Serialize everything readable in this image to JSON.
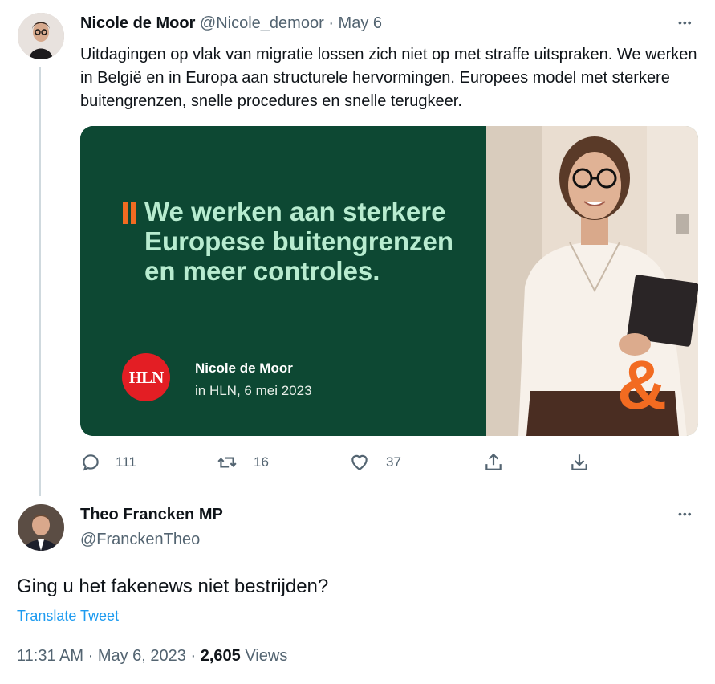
{
  "tweet1": {
    "author_name": "Nicole de Moor",
    "handle": "@Nicole_demoor",
    "separator": "·",
    "date": "May 6",
    "more": "•••",
    "text": "Uitdagingen op vlak van migratie lossen zich niet op met straffe uitspraken. We werken in België en in Europa aan structurele hervormingen. Europees model met sterkere buitengrenzen, snelle procedures en snelle terugkeer.",
    "card": {
      "headline": "We werken aan sterkere Europese buitengrenzen en meer controles.",
      "logo_text": "HLN",
      "author": "Nicole de Moor",
      "source": "in HLN, 6 mei 2023",
      "bg_color": "#0d4833",
      "headline_color": "#b8ecd0",
      "accent_color": "#f26b21"
    },
    "actions": {
      "reply_count": "111",
      "retweet_count": "16",
      "like_count": "37"
    }
  },
  "tweet2": {
    "author_name": "Theo Francken MP",
    "handle": "@FranckenTheo",
    "more": "•••",
    "text": "Ging u het fakenews niet bestrijden?",
    "translate": "Translate Tweet",
    "time": "11:31 AM",
    "separator1": "·",
    "date": "May 6, 2023",
    "separator2": "·",
    "views_count": "2,605",
    "views_label": "Views"
  },
  "colors": {
    "muted": "#536471",
    "link": "#1d9bf0",
    "thread_line": "#cfd9de"
  }
}
